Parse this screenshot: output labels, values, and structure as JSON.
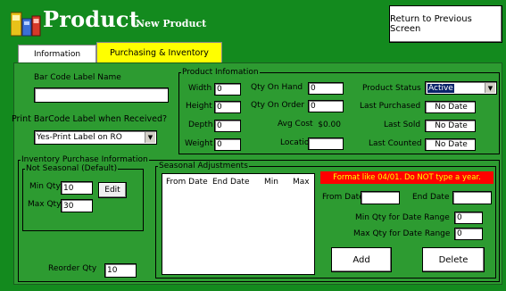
{
  "header": {
    "title": "Product",
    "subtitle": "New Product",
    "return_button": "Return to Previous Screen"
  },
  "tabs": [
    {
      "label": "Information"
    },
    {
      "label": "Purchasing & Inventory"
    }
  ],
  "barcode": {
    "label_name_label": "Bar Code Label Name",
    "label_name_value": "",
    "print_label": "Print BarCode Label when Received?",
    "print_value": "Yes-Print Label on RO"
  },
  "product_info": {
    "title": "Product Infomation",
    "width_label": "Width",
    "width_value": "0",
    "height_label": "Height",
    "height_value": "0",
    "depth_label": "Depth",
    "depth_value": "0",
    "weight_label": "Weight",
    "weight_value": "0",
    "qty_on_hand_label": "Qty On Hand",
    "qty_on_hand_value": "0",
    "qty_on_order_label": "Qty On Order",
    "qty_on_order_value": "0",
    "avg_cost_label": "Avg Cost",
    "avg_cost_value": "$0.00",
    "location_label": "Location",
    "location_value": "",
    "status_label": "Product Status",
    "status_value": "Active",
    "last_purchased_label": "Last Purchased",
    "last_purchased_value": "No Date",
    "last_sold_label": "Last Sold",
    "last_sold_value": "No Date",
    "last_counted_label": "Last Counted",
    "last_counted_value": "No Date"
  },
  "inventory": {
    "title": "Inventory Purchase Information",
    "not_seasonal_title": "Not Seasonal (Default)",
    "min_qty_label": "Min Qty",
    "min_qty_value": "10",
    "max_qty_label": "Max Qty",
    "max_qty_value": "30",
    "edit_button": "Edit",
    "reorder_label": "Reorder Qty",
    "reorder_value": "10"
  },
  "seasonal": {
    "title": "Seasonal Adjustments",
    "columns": [
      "From Date",
      "End Date",
      "Min",
      "Max"
    ],
    "warning": "Format like 04/01. Do NOT type a year.",
    "from_date_label": "From Date",
    "from_date_value": "",
    "end_date_label": "End Date",
    "end_date_value": "",
    "min_range_label": "Min Qty for Date Range",
    "min_range_value": "0",
    "max_range_label": "Max Qty for Date Range",
    "max_range_value": "0",
    "add_button": "Add",
    "delete_button": "Delete"
  }
}
